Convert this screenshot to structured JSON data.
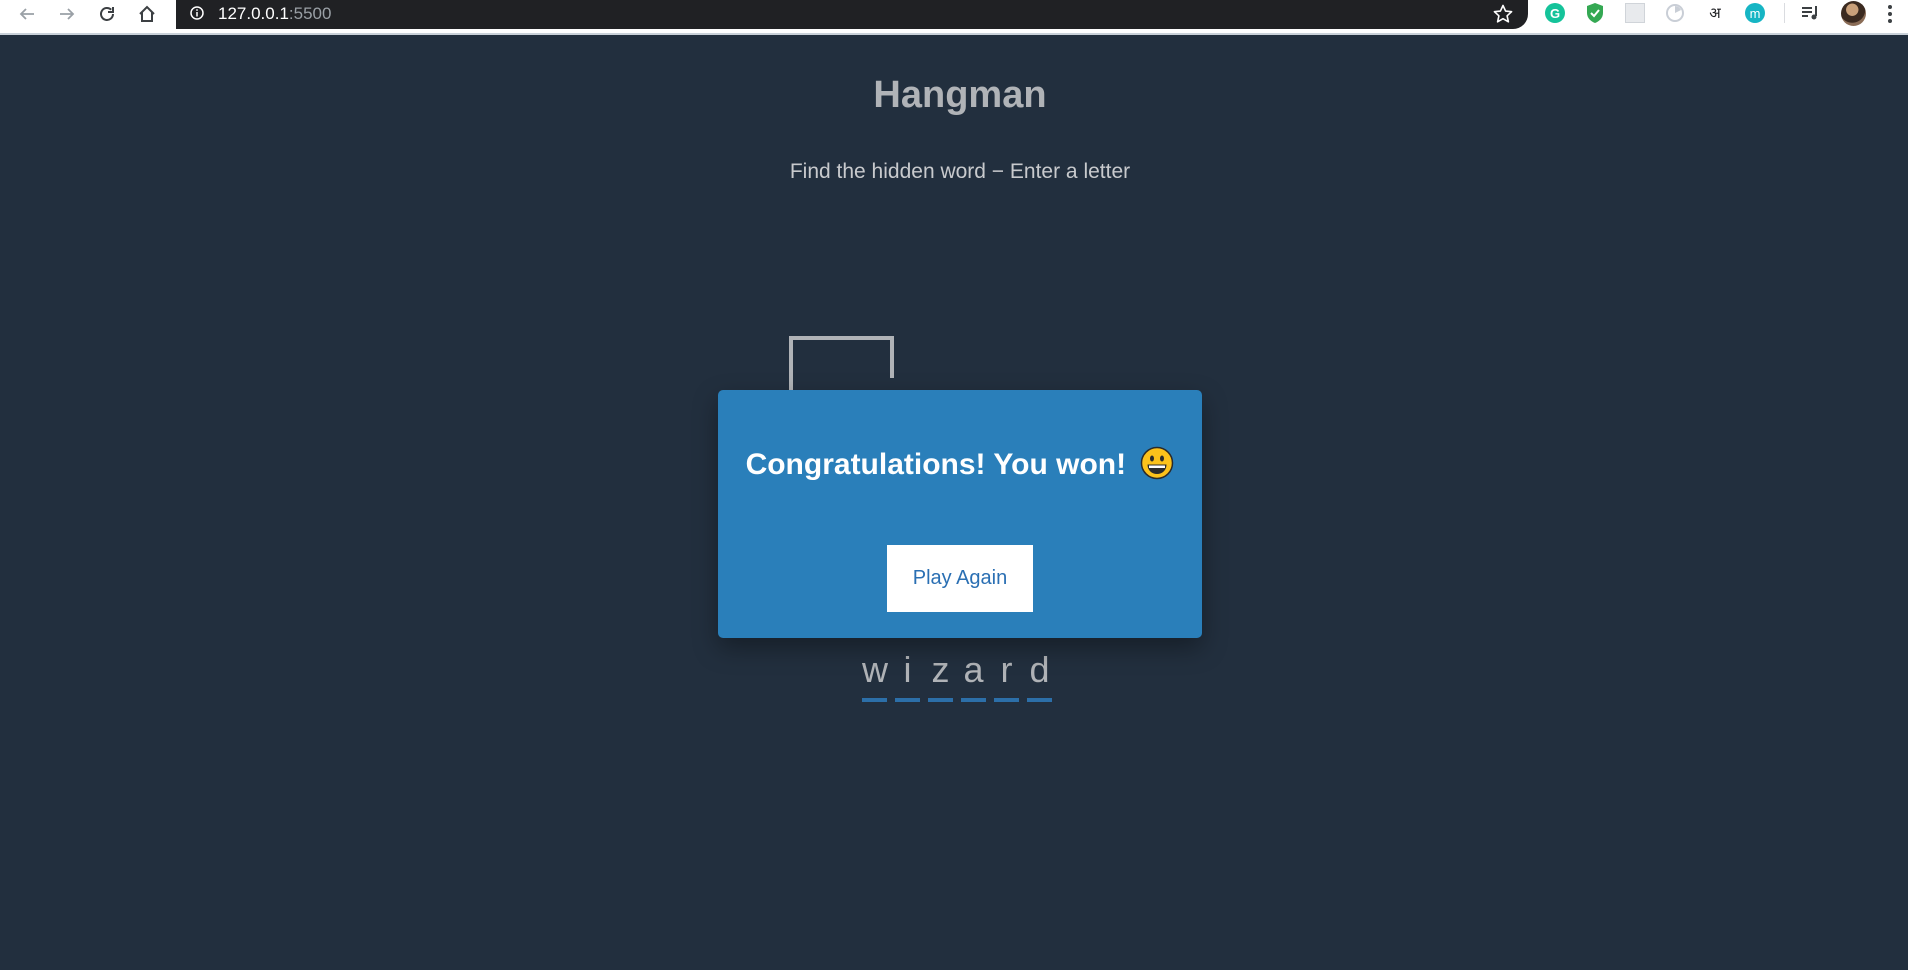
{
  "browser": {
    "url_host": "127.0.0.1",
    "url_port": ":5500",
    "extensions": [
      {
        "name": "grammarly-icon",
        "letter": "G",
        "color": "#15c39a"
      },
      {
        "name": "shield-check-icon",
        "color": "#34a853"
      },
      {
        "name": "tile-extension-icon",
        "color": "#d5d9de"
      },
      {
        "name": "pie-extension-icon",
        "color": "#c9ced6"
      },
      {
        "name": "hindi-extension-icon",
        "letter": "अ",
        "color": "#202124"
      },
      {
        "name": "m-extension-icon",
        "letter": "m",
        "color": "#16b5c4"
      }
    ]
  },
  "page": {
    "title": "Hangman",
    "subtitle": "Find the hidden word − Enter a letter"
  },
  "word": {
    "letters": [
      "w",
      "i",
      "z",
      "a",
      "r",
      "d"
    ]
  },
  "modal": {
    "message": "Congratulations! You won!",
    "emoji": "😃",
    "button_label": "Play Again"
  },
  "colors": {
    "background": "#222f3e",
    "modal": "#2a7fba",
    "underline": "#2c6fa8",
    "title_text": "#b0b3b7"
  }
}
